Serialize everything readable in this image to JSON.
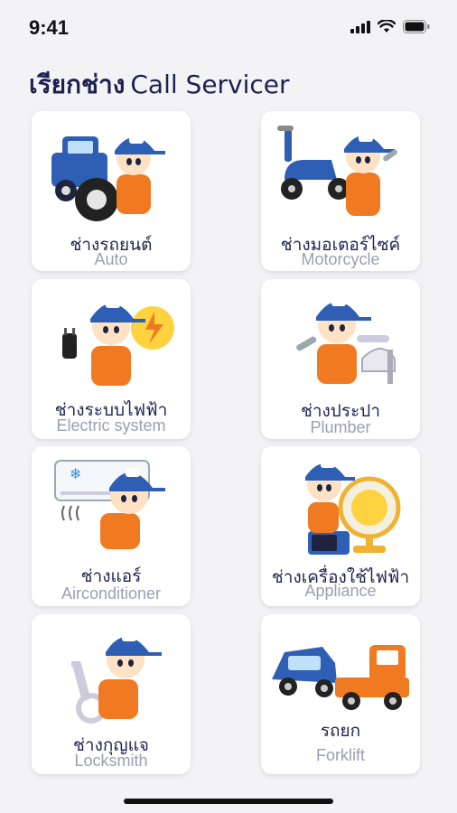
{
  "status_bar": {
    "time": "9:41",
    "icons": [
      "signal-icon",
      "wifi-icon",
      "battery-icon"
    ]
  },
  "header": {
    "title_th": "เรียกช่าง",
    "title_en": "Call Servicer"
  },
  "services": [
    {
      "th": "ช่างรถยนต์",
      "en": "Auto",
      "icon": "auto-mechanic-icon"
    },
    {
      "th": "ช่างมอเตอร์ไซค์",
      "en": "Motorcycle",
      "icon": "motorcycle-mechanic-icon"
    },
    {
      "th": "ช่างระบบไฟฟ้า",
      "en": "Electric system",
      "icon": "electrician-icon"
    },
    {
      "th": "ช่างประปา",
      "en": "Plumber",
      "icon": "plumber-icon"
    },
    {
      "th": "ช่างแอร์",
      "en": "Airconditioner",
      "icon": "aircon-technician-icon"
    },
    {
      "th": "ช่างเครื่องใช้ไฟฟ้า",
      "en": "Appliance",
      "icon": "appliance-technician-icon"
    },
    {
      "th": "ช่างกุญแจ",
      "en": "Locksmith",
      "icon": "locksmith-icon"
    },
    {
      "th": "รถยก",
      "en": "Forklift",
      "icon": "tow-truck-icon"
    }
  ],
  "colors": {
    "brand_blue": "#2f5fb5",
    "brand_orange": "#f07a22",
    "title": "#1e2150",
    "subtitle": "#9a9fb0"
  }
}
